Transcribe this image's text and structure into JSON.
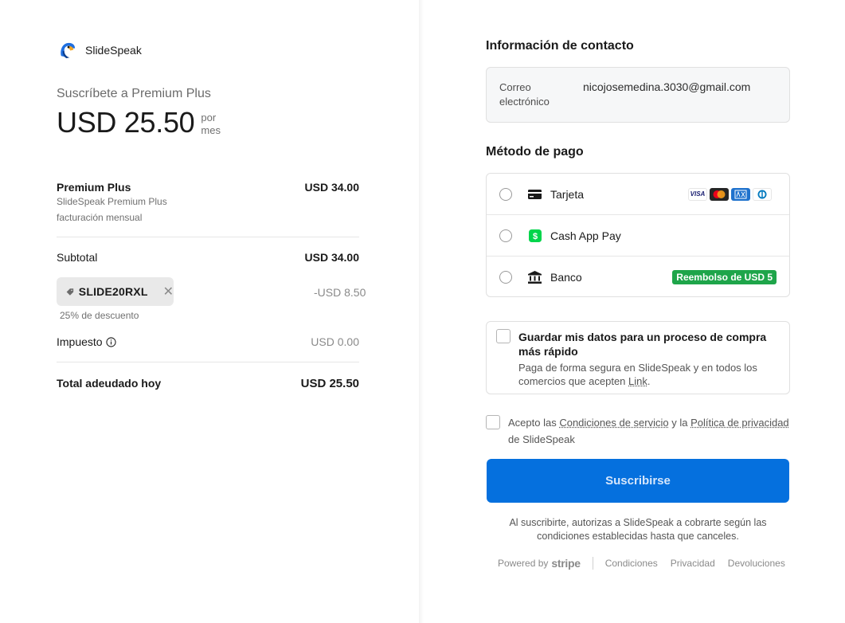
{
  "brand": {
    "name": "SlideSpeak",
    "logo_icon": "parrot-logo-icon"
  },
  "summary": {
    "subscribe_title": "Suscríbete a Premium Plus",
    "price": "USD 25.50",
    "period_line1": "por",
    "period_line2": "mes"
  },
  "line_item": {
    "name": "Premium Plus",
    "amount": "USD 34.00",
    "desc1": "SlideSpeak Premium Plus",
    "desc2": "facturación mensual"
  },
  "subtotal": {
    "label": "Subtotal",
    "amount": "USD 34.00"
  },
  "promo": {
    "code": "SLIDE20RXL",
    "amount": "-USD 8.50",
    "discount": "25% de descuento",
    "icon": "tag-icon"
  },
  "tax": {
    "label": "Impuesto",
    "amount": "USD 0.00",
    "icon": "info-icon"
  },
  "total": {
    "label": "Total adeudado hoy",
    "amount": "USD 25.50"
  },
  "contact": {
    "title": "Información de contacto",
    "email_label": "Correo electrónico",
    "email_value": "nicojosemedina.3030@gmail.com"
  },
  "payment": {
    "title": "Método de pago",
    "options": [
      {
        "label": "Tarjeta",
        "icon": "credit-card-icon"
      },
      {
        "label": "Cash App Pay",
        "icon": "cash-app-icon"
      },
      {
        "label": "Banco",
        "icon": "bank-icon",
        "badge": "Reembolso de USD 5"
      }
    ],
    "card_brands": [
      "VISA",
      "mastercard",
      "amex",
      "diners"
    ],
    "visa_label": "VISA"
  },
  "save": {
    "title": "Guardar mis datos para un proceso de compra más rápido",
    "desc_before": "Paga de forma segura en SlideSpeak y en todos los comercios que acepten ",
    "desc_link": "Link",
    "desc_after": "."
  },
  "terms": {
    "before": "Acepto las ",
    "link1": "Condiciones de servicio",
    "middle": " y la ",
    "link2": "Política de privacidad",
    "after": " de SlideSpeak"
  },
  "subscribe_button": "Suscribirse",
  "authorize_text": "Al suscribirte, autorizas a SlideSpeak a cobrarte según las condiciones establecidas hasta que canceles.",
  "footer": {
    "powered_by": "Powered by",
    "stripe": "stripe",
    "links": [
      "Condiciones",
      "Privacidad",
      "Devoluciones"
    ]
  },
  "colors": {
    "accent": "#0570de",
    "badge_green": "#1ea54a",
    "cashapp_green": "#00d54b"
  }
}
